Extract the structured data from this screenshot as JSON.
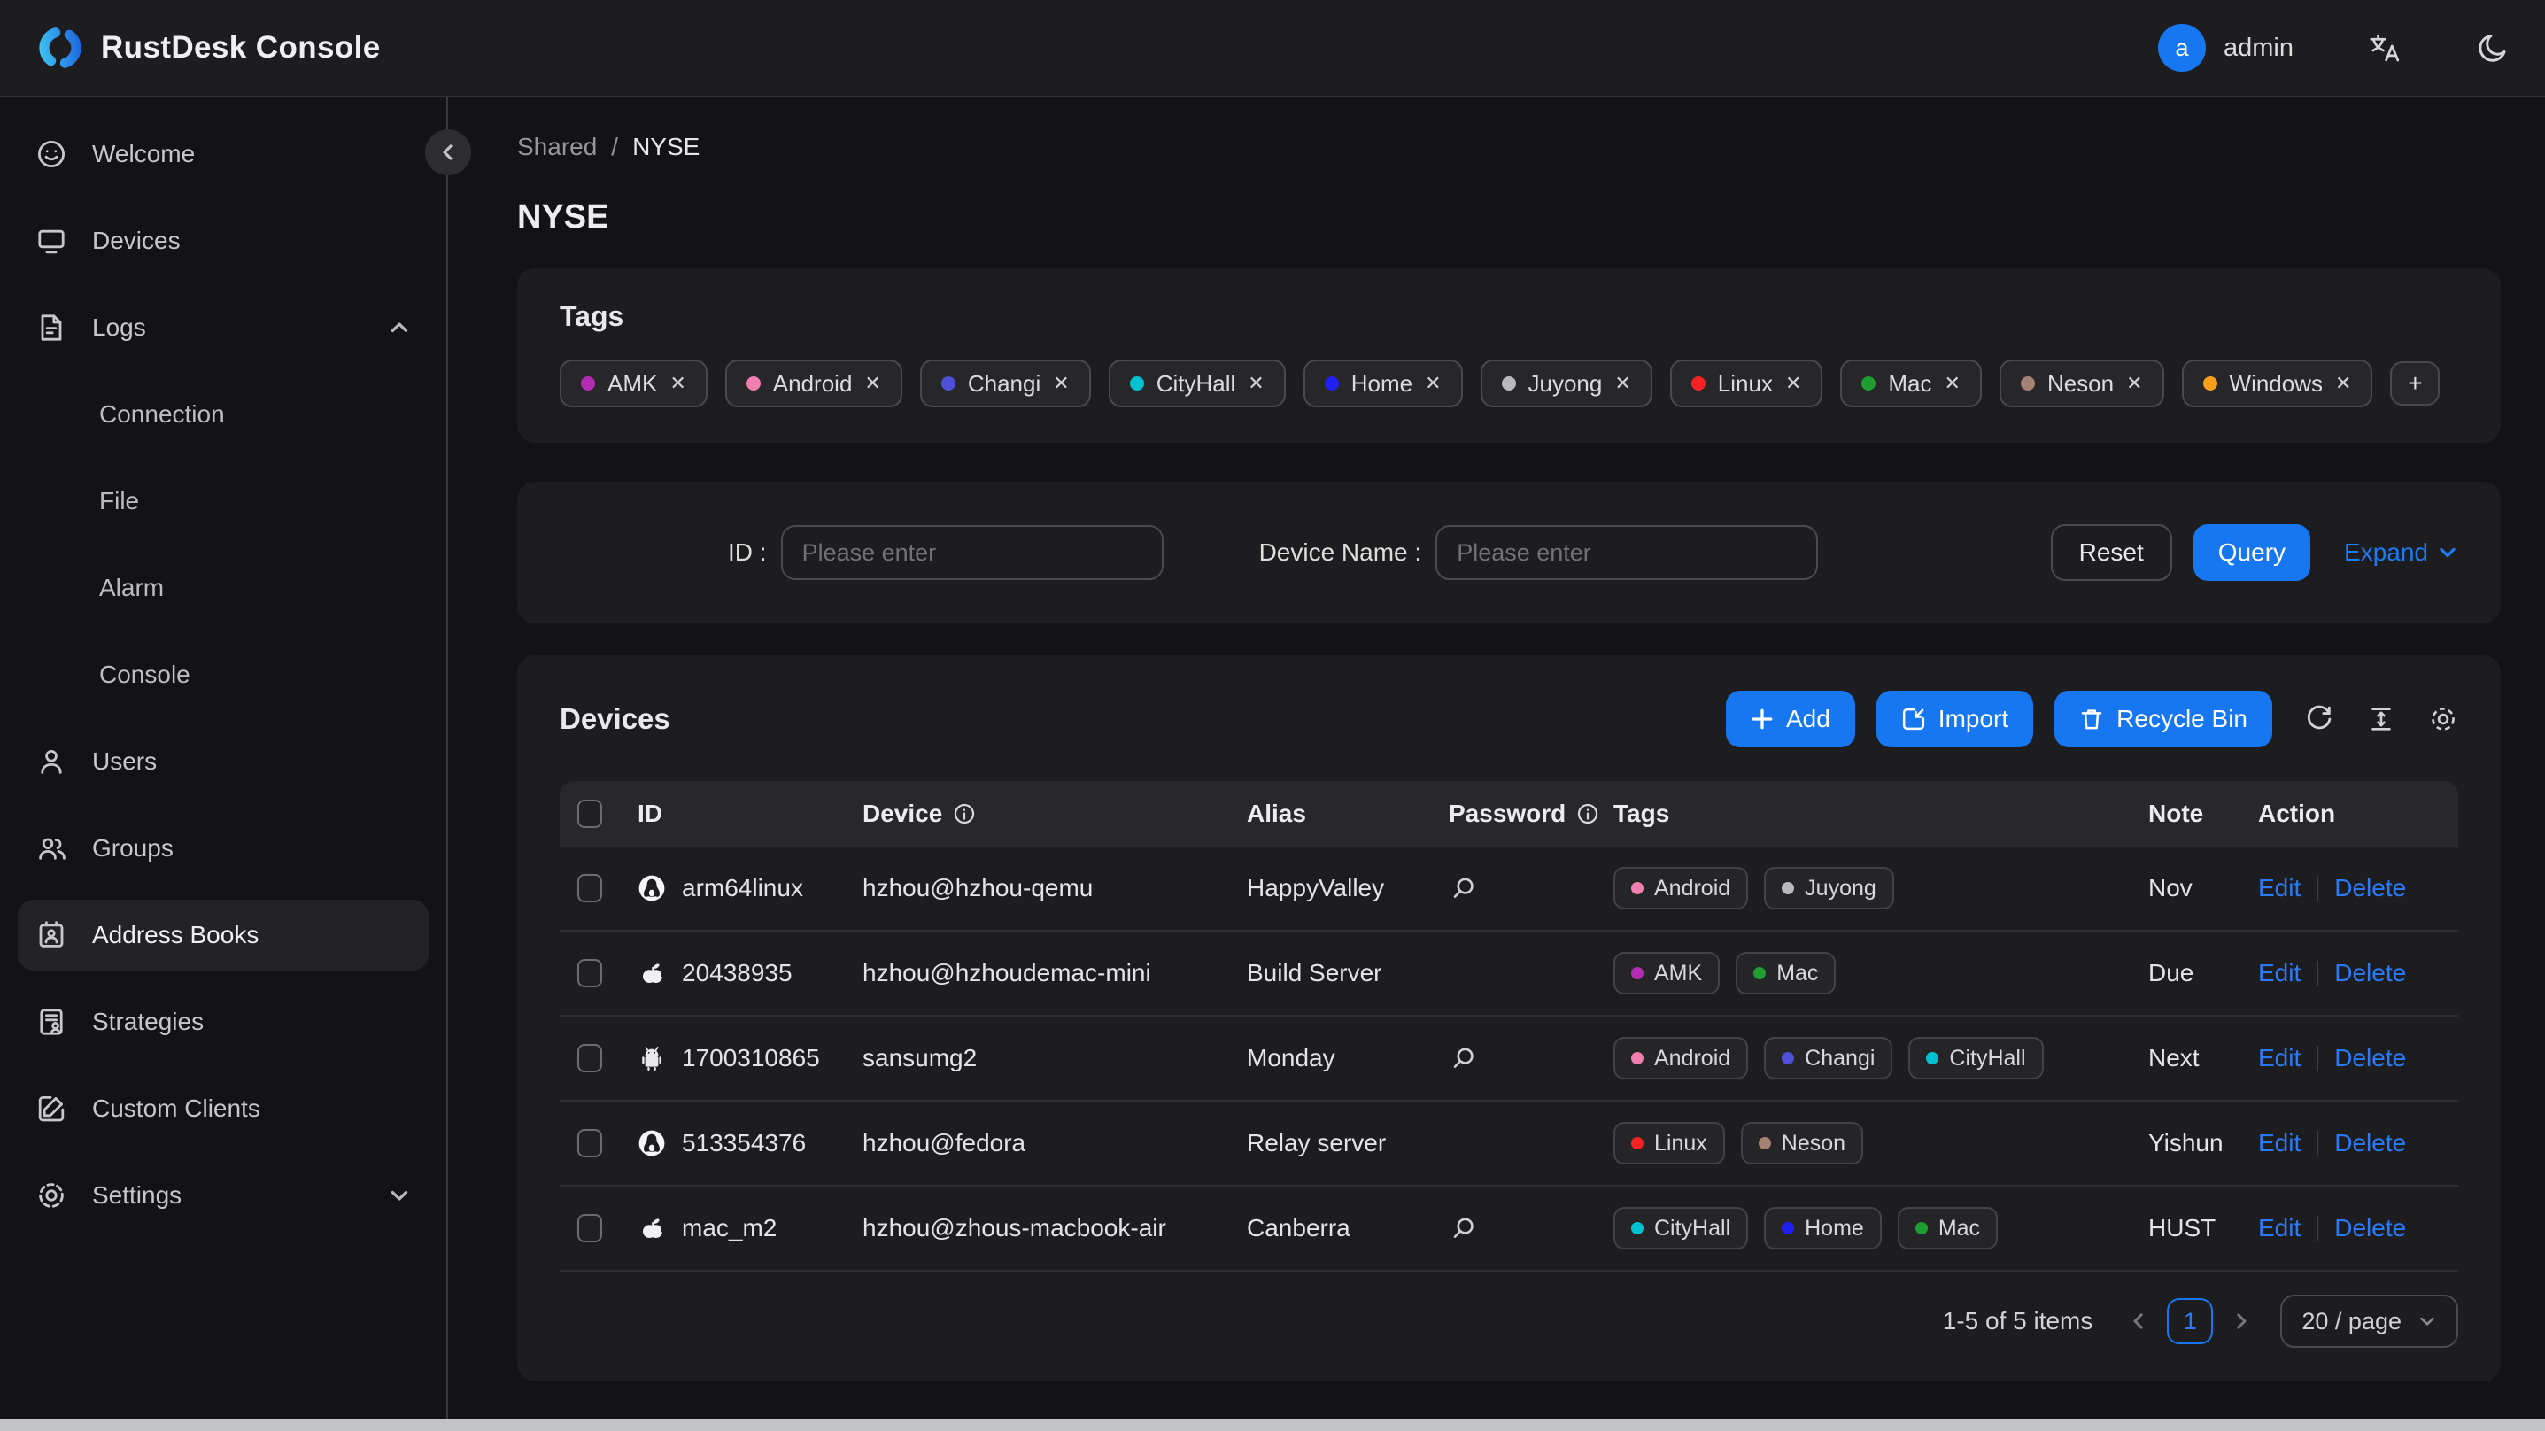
{
  "topbar": {
    "title": "RustDesk Console",
    "user": {
      "initial": "a",
      "name": "admin"
    }
  },
  "sidebar": {
    "items": [
      {
        "label": "Welcome",
        "icon": "smiley"
      },
      {
        "label": "Devices",
        "icon": "monitor"
      },
      {
        "label": "Logs",
        "icon": "document",
        "chevron": "up",
        "children": [
          "Connection",
          "File",
          "Alarm",
          "Console"
        ]
      },
      {
        "label": "Users",
        "icon": "user"
      },
      {
        "label": "Groups",
        "icon": "users"
      },
      {
        "label": "Address Books",
        "icon": "address-book",
        "selected": true
      },
      {
        "label": "Strategies",
        "icon": "strategy"
      },
      {
        "label": "Custom Clients",
        "icon": "edit-square"
      },
      {
        "label": "Settings",
        "icon": "gear",
        "chevron": "down"
      }
    ]
  },
  "breadcrumb": {
    "parent": "Shared",
    "separator": "/",
    "current": "NYSE"
  },
  "page_title": "NYSE",
  "tag_colors": {
    "AMK": "#b42cb6",
    "Android": "#ef7fae",
    "Changi": "#4e51d8",
    "CityHall": "#00c2d1",
    "Home": "#1f1ff2",
    "Juyong": "#b9b9bc",
    "Linux": "#f52224",
    "Mac": "#1d9e2f",
    "Neson": "#a58274",
    "Windows": "#f9a01b"
  },
  "tags_card": {
    "title": "Tags",
    "tags": [
      "AMK",
      "Android",
      "Changi",
      "CityHall",
      "Home",
      "Juyong",
      "Linux",
      "Mac",
      "Neson",
      "Windows"
    ],
    "remove_glyph": "✕",
    "add_label": "+"
  },
  "filter": {
    "id_label": "ID :",
    "id_placeholder": "Please enter",
    "device_name_label": "Device Name :",
    "device_name_placeholder": "Please enter",
    "reset_label": "Reset",
    "query_label": "Query",
    "expand_label": "Expand"
  },
  "devices_card": {
    "title": "Devices",
    "add_label": "Add",
    "import_label": "Import",
    "recycle_label": "Recycle Bin"
  },
  "table": {
    "columns": [
      {
        "label": "ID"
      },
      {
        "label": "Device",
        "info": true
      },
      {
        "label": "Alias"
      },
      {
        "label": "Password",
        "info": true
      },
      {
        "label": "Tags"
      },
      {
        "label": "Note"
      },
      {
        "label": "Action"
      }
    ],
    "action_labels": [
      "Edit",
      "Delete"
    ],
    "rows": [
      {
        "os": "linux",
        "id": "arm64linux",
        "device": "hzhou@hzhou-qemu",
        "alias": "HappyValley",
        "has_password": true,
        "tags": [
          "Android",
          "Juyong"
        ],
        "note": "Nov"
      },
      {
        "os": "apple",
        "id": "20438935",
        "device": "hzhou@hzhoudemac-mini",
        "alias": "Build Server",
        "has_password": false,
        "tags": [
          "AMK",
          "Mac"
        ],
        "note": "Due"
      },
      {
        "os": "android",
        "id": "1700310865",
        "device": "sansumg2",
        "alias": "Monday",
        "has_password": true,
        "tags": [
          "Android",
          "Changi",
          "CityHall"
        ],
        "note": "Next"
      },
      {
        "os": "linux",
        "id": "513354376",
        "device": "hzhou@fedora",
        "alias": "Relay server",
        "has_password": false,
        "tags": [
          "Linux",
          "Neson"
        ],
        "note": "Yishun"
      },
      {
        "os": "apple",
        "id": "mac_m2",
        "device": "hzhou@zhous-macbook-air",
        "alias": "Canberra",
        "has_password": true,
        "tags": [
          "CityHall",
          "Home",
          "Mac"
        ],
        "note": "HUST"
      }
    ]
  },
  "pagination": {
    "summary": "1-5 of 5 items",
    "page": "1",
    "page_size": "20 / page"
  }
}
